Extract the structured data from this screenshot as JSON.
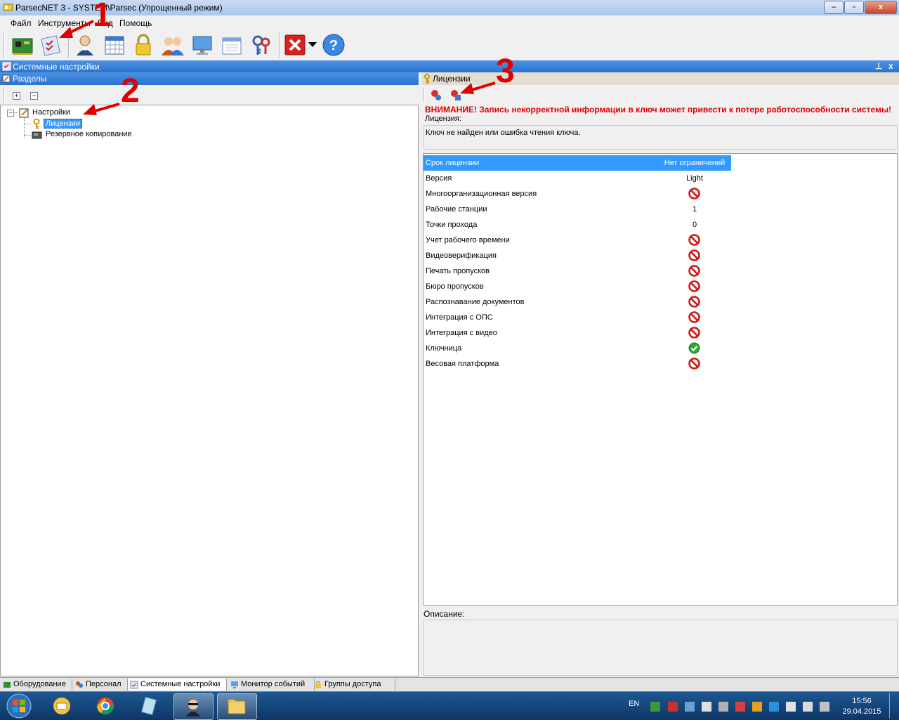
{
  "window": {
    "title": "ParsecNET 3 - SYSTEM\\Parsec (Упрощенный режим)",
    "controls": {
      "minimize": "–",
      "maximize": "▫",
      "close": "x"
    }
  },
  "menu": [
    "Файл",
    "Инструменты",
    "Вид",
    "Помощь"
  ],
  "toolbar": {
    "icons": [
      "hardware-board-icon",
      "settings-checklist-icon",
      "personnel-icon",
      "schedule-table-icon",
      "lock-icon",
      "users-group-icon",
      "monitor-icon",
      "calendar-icon",
      "keys-icon",
      "exit-icon",
      "dropdown-arrow-icon",
      "help-icon"
    ]
  },
  "system_panel": {
    "title": "Системные настройки",
    "pin": "⊥",
    "close": "x"
  },
  "sections": {
    "title": "Разделы",
    "expand": "+",
    "collapse": "−",
    "tree": {
      "root": "Настройки",
      "children": [
        "Лицензии",
        "Резервное копирование"
      ]
    }
  },
  "license_panel": {
    "title": "Лицензии",
    "warning": "ВНИМАНИЕ! Запись некорректной информации в ключ может привести к потере работоспособности системы!",
    "license_label": "Лицензия:",
    "license_value": "Ключ не найден или ошибка чтения ключа.",
    "rows": [
      {
        "name": "Срок лицензии",
        "value": "Нет ограничений",
        "icon": null
      },
      {
        "name": "Версия",
        "value": "Light",
        "icon": null
      },
      {
        "name": "Многоорганизационная версия",
        "value": null,
        "icon": "forbidden"
      },
      {
        "name": "Рабочие станции",
        "value": "1",
        "icon": null
      },
      {
        "name": "Точки прохода",
        "value": "0",
        "icon": null
      },
      {
        "name": "Учет рабочего времени",
        "value": null,
        "icon": "forbidden"
      },
      {
        "name": "Видеоверификация",
        "value": null,
        "icon": "forbidden"
      },
      {
        "name": "Печать пропусков",
        "value": null,
        "icon": "forbidden"
      },
      {
        "name": "Бюро пропусков",
        "value": null,
        "icon": "forbidden"
      },
      {
        "name": "Распознавание документов",
        "value": null,
        "icon": "forbidden"
      },
      {
        "name": "Интеграция с ОПС",
        "value": null,
        "icon": "forbidden"
      },
      {
        "name": "Интеграция с видео",
        "value": null,
        "icon": "forbidden"
      },
      {
        "name": "Ключница",
        "value": null,
        "icon": "check"
      },
      {
        "name": "Весовая платформа",
        "value": null,
        "icon": "forbidden"
      }
    ],
    "description_label": "Описание:"
  },
  "tabs": [
    "Оборудование",
    "Персонал",
    "Системные настройки",
    "Монитор событий",
    "Группы доступа"
  ],
  "taskbar": {
    "lang": "EN",
    "time": "15:56",
    "date": "29.04.2015"
  },
  "annotations": [
    "1",
    "2",
    "3"
  ],
  "colors": {
    "accent": "#3399ff",
    "warning": "#e00000",
    "header": "#2a73d0"
  }
}
